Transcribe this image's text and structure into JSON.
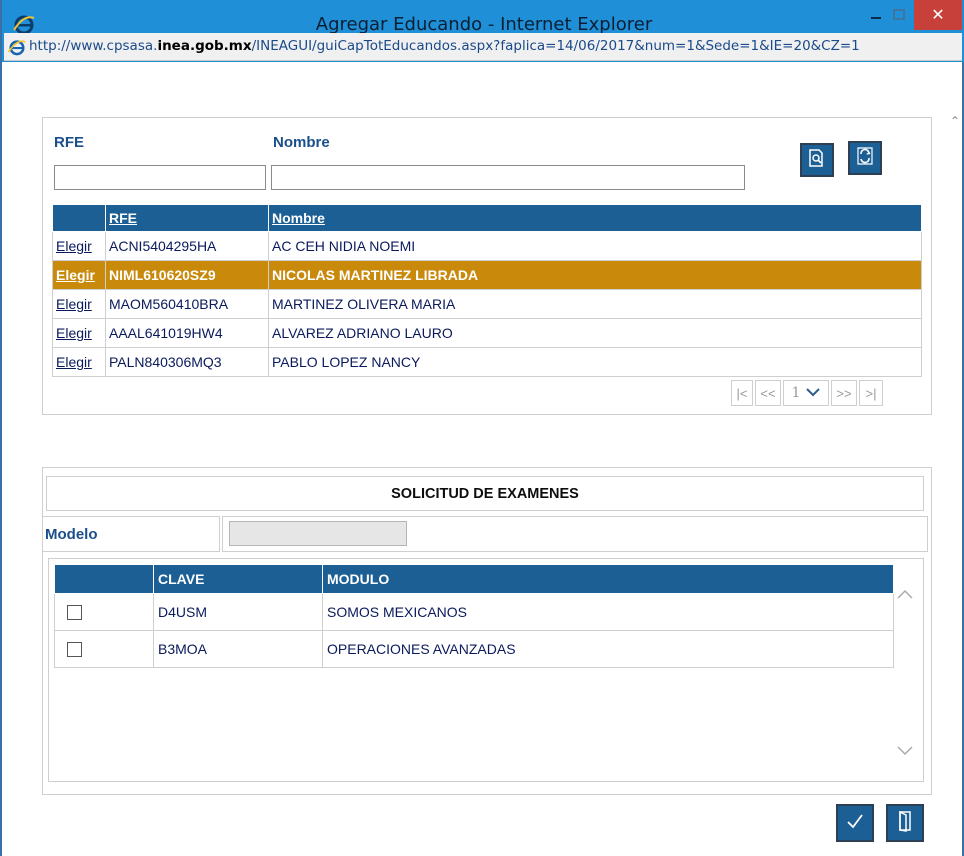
{
  "window": {
    "title": "Agregar Educando - Internet Explorer",
    "url_prefix": "http://www.cpsasa.",
    "url_domain": "inea.gob.mx",
    "url_rest": "/INEAGUI/guiCapTotEducandos.aspx?faplica=14/06/2017&num=1&Sede=1&IE=20&CZ=1"
  },
  "search": {
    "rfe_label": "RFE",
    "nombre_label": "Nombre",
    "rfe_value": "",
    "nombre_value": ""
  },
  "results": {
    "headers": [
      "",
      "RFE",
      "Nombre"
    ],
    "link_label": "Elegir",
    "rows": [
      {
        "rfe": "ACNI5404295HA",
        "nombre": "AC CEH NIDIA NOEMI",
        "selected": false
      },
      {
        "rfe": "NIML610620SZ9",
        "nombre": "NICOLAS MARTINEZ LIBRADA",
        "selected": true
      },
      {
        "rfe": "MAOM560410BRA",
        "nombre": "MARTINEZ OLIVERA MARIA",
        "selected": false
      },
      {
        "rfe": "AAAL641019HW4",
        "nombre": "ALVAREZ ADRIANO LAURO",
        "selected": false
      },
      {
        "rfe": "PALN840306MQ3",
        "nombre": "PABLO LOPEZ NANCY",
        "selected": false
      }
    ]
  },
  "pager": {
    "first": "|<",
    "prev": "<<",
    "page": "1",
    "next": ">>",
    "last": ">|"
  },
  "exams": {
    "title": "SOLICITUD DE EXAMENES",
    "modelo_label": "Modelo",
    "modelo_value": "",
    "headers": [
      "",
      "CLAVE",
      "MODULO"
    ],
    "rows": [
      {
        "clave": "D4USM",
        "modulo": "SOMOS MEXICANOS",
        "checked": false
      },
      {
        "clave": "B3MOA",
        "modulo": "OPERACIONES AVANZADAS",
        "checked": false
      }
    ]
  },
  "colors": {
    "header_blue": "#1c5f94",
    "selected_row": "#c98a0c",
    "label_blue": "#1a4f8a",
    "titlebar": "#1f8fd8",
    "close_red": "#c7413a"
  },
  "icons": {
    "search_button": "magnifier-document-icon",
    "refresh_button": "refresh-icon",
    "accept_button": "checkmark-icon",
    "exit_button": "door-exit-icon"
  }
}
